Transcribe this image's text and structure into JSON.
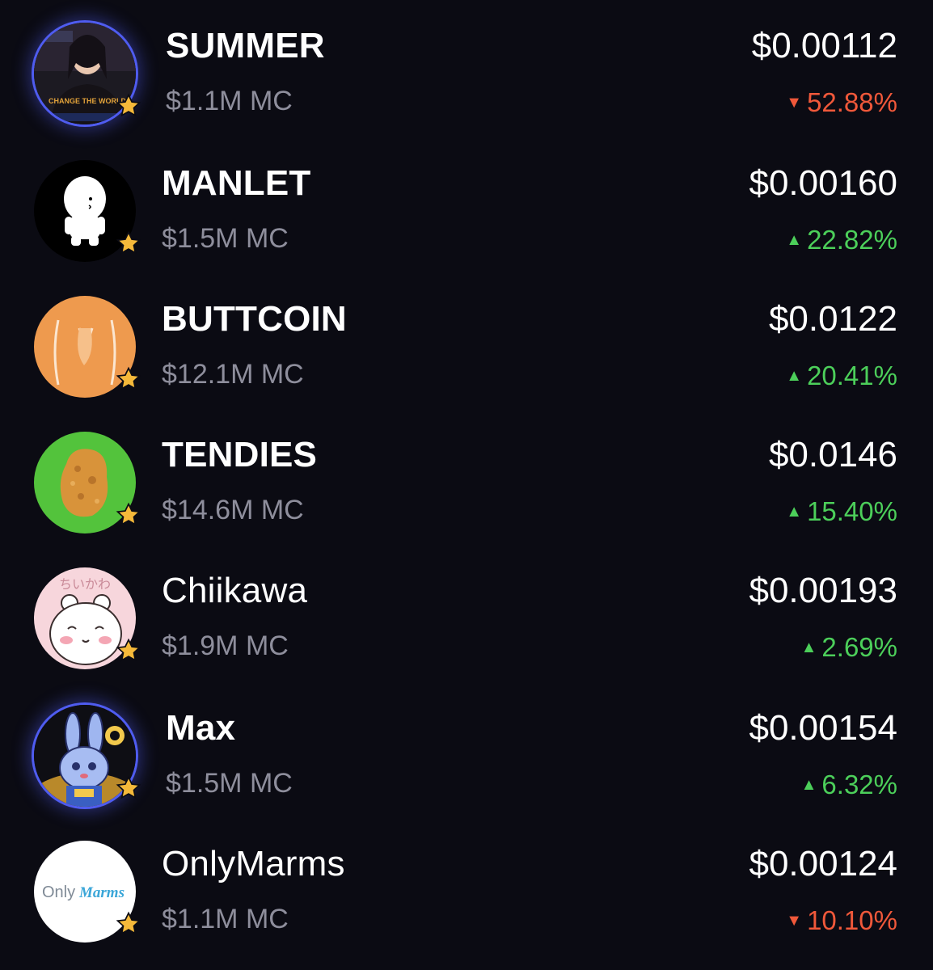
{
  "colors": {
    "background": "#0b0b13",
    "up": "#4ccf5a",
    "down": "#f0583a",
    "muted": "#8e8e9c",
    "star": "#f5b93a",
    "ring": "#4f5cf0"
  },
  "tokens": [
    {
      "name": "SUMMER",
      "market_cap": "$1.1M MC",
      "price": "$0.00112",
      "change": "52.88%",
      "direction": "down",
      "arrow": "▼",
      "avatar_icon": "summer-avatar-icon",
      "avatar_text": "CHANGE THE WORLD"
    },
    {
      "name": "MANLET",
      "market_cap": "$1.5M MC",
      "price": "$0.00160",
      "change": "22.82%",
      "direction": "up",
      "arrow": "▲",
      "avatar_icon": "manlet-avatar-icon"
    },
    {
      "name": "BUTTCOIN",
      "market_cap": "$12.1M MC",
      "price": "$0.0122",
      "change": "20.41%",
      "direction": "up",
      "arrow": "▲",
      "avatar_icon": "buttcoin-avatar-icon"
    },
    {
      "name": "TENDIES",
      "market_cap": "$14.6M MC",
      "price": "$0.0146",
      "change": "15.40%",
      "direction": "up",
      "arrow": "▲",
      "avatar_icon": "tendies-avatar-icon"
    },
    {
      "name": "Chiikawa",
      "market_cap": "$1.9M MC",
      "price": "$0.00193",
      "change": "2.69%",
      "direction": "up",
      "arrow": "▲",
      "avatar_icon": "chiikawa-avatar-icon",
      "avatar_text": "ちいかわ"
    },
    {
      "name": "Max",
      "market_cap": "$1.5M MC",
      "price": "$0.00154",
      "change": "6.32%",
      "direction": "up",
      "arrow": "▲",
      "avatar_icon": "max-avatar-icon"
    },
    {
      "name": "OnlyMarms",
      "market_cap": "$1.1M MC",
      "price": "$0.00124",
      "change": "10.10%",
      "direction": "down",
      "arrow": "▼",
      "avatar_icon": "onlymarms-avatar-icon",
      "avatar_text_1": "Only",
      "avatar_text_2": "Marms"
    }
  ]
}
